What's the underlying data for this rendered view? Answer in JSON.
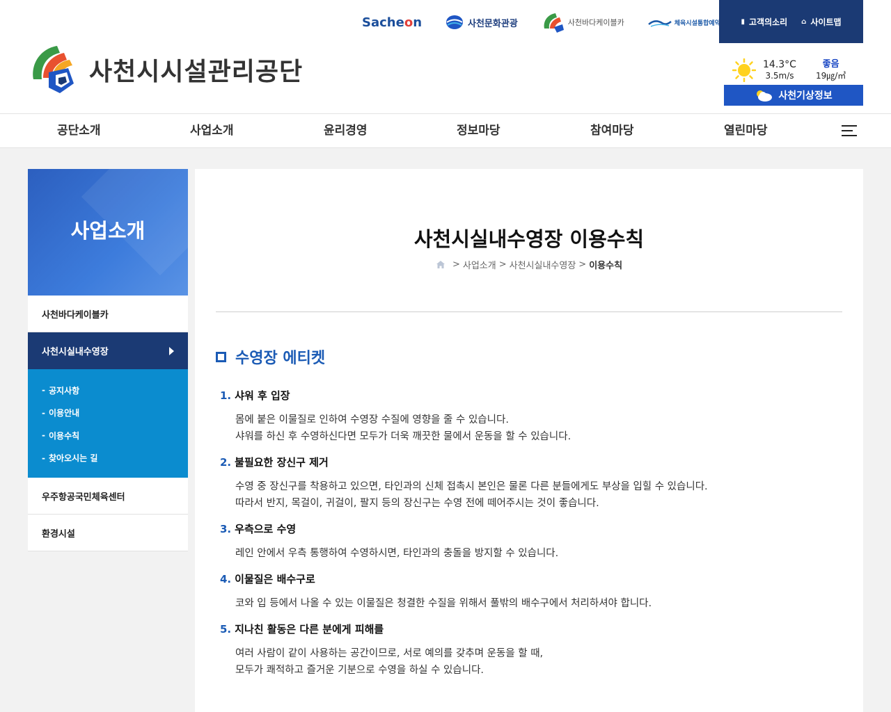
{
  "header": {
    "brand_text": "사천시시설관리공단",
    "family": {
      "sacheon_prefix": "Sache",
      "sacheon_o": "o",
      "sacheon_suffix": "n",
      "culture": "사천문화관광",
      "cable": "사천바다케이블카",
      "sports": "체육시설통합예약"
    },
    "util": {
      "voice": "고객의소리",
      "sitemap": "사이트맵"
    },
    "weather": {
      "temp": "14.3°C",
      "wind": "3.5m/s",
      "air_status": "좋음",
      "air_value": "19㎍/㎥",
      "button": "사천기상정보"
    }
  },
  "gnb": [
    "공단소개",
    "사업소개",
    "윤리경영",
    "정보마당",
    "참여마당",
    "열린마당"
  ],
  "side": {
    "title": "사업소개",
    "items": [
      {
        "label": "사천바다케이블카"
      },
      {
        "label": "사천시실내수영장"
      },
      {
        "label": "우주항공국민체육센터"
      },
      {
        "label": "환경시설"
      }
    ],
    "sub": [
      {
        "label": "공지사항"
      },
      {
        "label": "이용안내"
      },
      {
        "label": "이용수칙"
      },
      {
        "label": "찾아오시는 길"
      }
    ]
  },
  "main": {
    "title": "사천시실내수영장 이용수칙",
    "breadcrumb": {
      "sep": ">",
      "b1": "사업소개",
      "b2": "사천시실내수영장",
      "current": "이용수칙"
    },
    "section_title": "수영장 에티켓",
    "rules": [
      {
        "num": "1.",
        "title": "샤워 후 입장",
        "lines": [
          "몸에 붙은 이물질로 인하여 수영장 수질에 영향을 줄 수 있습니다.",
          "샤워를 하신 후 수영하신다면 모두가 더욱 깨끗한 물에서 운동을 할 수 있습니다."
        ]
      },
      {
        "num": "2.",
        "title": "불필요한 장신구 제거",
        "lines": [
          "수영 중 장신구를 착용하고 있으면, 타인과의 신체 접촉시 본인은 물론 다른 분들에게도 부상을 입힐 수 있습니다.",
          "따라서 반지, 목걸이, 귀걸이, 팔지 등의 장신구는 수영 전에 떼어주시는 것이 좋습니다."
        ]
      },
      {
        "num": "3.",
        "title": "우측으로 수영",
        "lines": [
          "레인 안에서 우측 통행하여 수영하시면, 타인과의 충돌을 방지할 수 있습니다."
        ]
      },
      {
        "num": "4.",
        "title": "이물질은 배수구로",
        "lines": [
          "코와 입 등에서 나올 수 있는 이물질은 청결한 수질을 위해서 풀밖의 배수구에서 처리하셔야 합니다."
        ]
      },
      {
        "num": "5.",
        "title": "지나친 활동은 다른 분에게 피해를",
        "lines": [
          "여러 사람이 같이 사용하는 공간이므로, 서로 예의를 갖추며 운동을 할 때,",
          "모두가 쾌적하고 즐거운 기분으로 수영을 하실 수 있습니다."
        ]
      }
    ]
  },
  "colors": {
    "navy": "#1b3a74",
    "accent_blue": "#1b5bb5",
    "sub_blue": "#0b8ccf",
    "hero_blue": "#3d7cdc"
  }
}
